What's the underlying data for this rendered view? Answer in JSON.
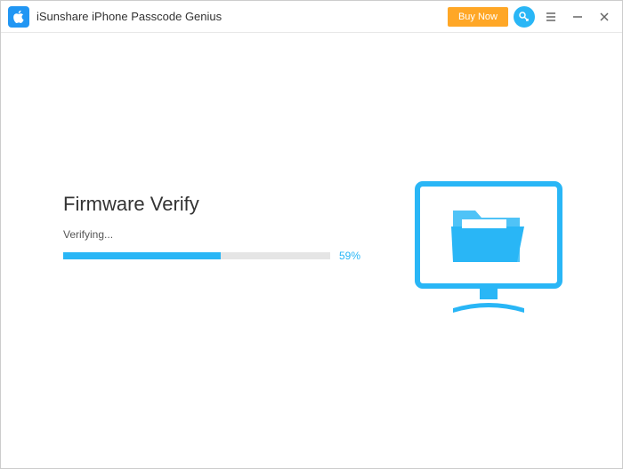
{
  "titlebar": {
    "app_name": "iSunshare iPhone Passcode Genius",
    "buy_label": "Buy Now"
  },
  "main": {
    "heading": "Firmware Verify",
    "status": "Verifying...",
    "progress_percent": 59,
    "progress_label": "59%"
  },
  "colors": {
    "accent": "#29B6F6",
    "buy": "#FFA726"
  }
}
